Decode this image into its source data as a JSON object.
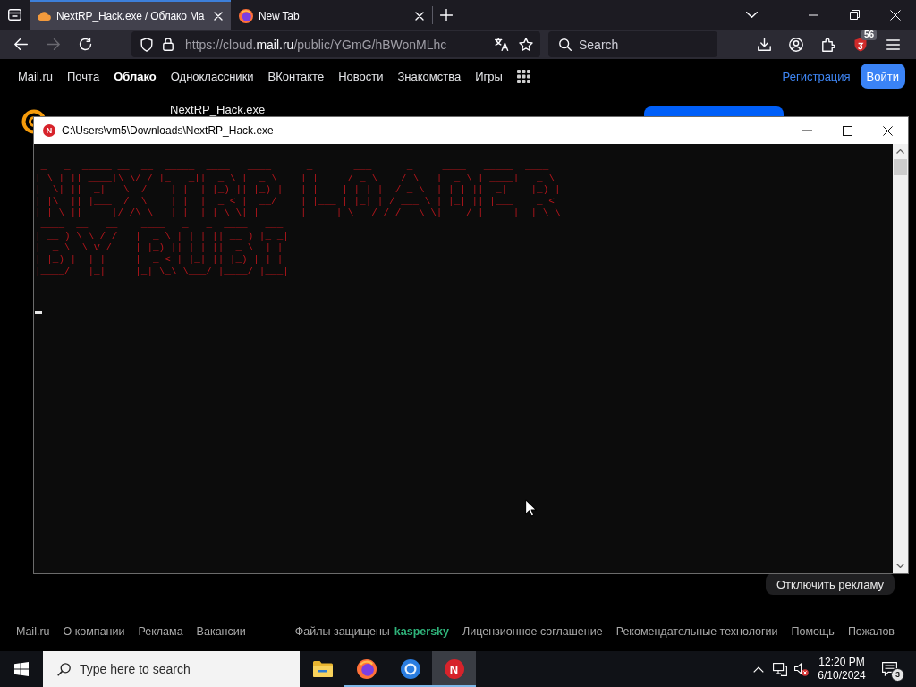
{
  "browser": {
    "tabs": [
      {
        "kind": "cloud",
        "title": "NextRP_Hack.exe / Облако Ma",
        "selected": true
      },
      {
        "kind": "browser",
        "title": "New Tab",
        "selected": false
      }
    ],
    "nav_buttons": [
      {
        "kind": "back",
        "disabled": false
      },
      {
        "kind": "forward",
        "disabled": true
      },
      {
        "kind": "reload",
        "disabled": false
      }
    ],
    "url": {
      "prefix": "https://cloud.",
      "domain": "mail.ru",
      "path": "/public/YGmG/hBWonMLhc"
    },
    "search": {
      "placeholder": "Search"
    },
    "extension_badge": "56"
  },
  "portal_nav": {
    "items": [
      {
        "label": "Mail.ru",
        "selected": false
      },
      {
        "label": "Почта",
        "selected": false
      },
      {
        "label": "Облако",
        "selected": true
      },
      {
        "label": "Одноклассники",
        "selected": false
      },
      {
        "label": "ВКонтакте",
        "selected": false
      },
      {
        "label": "Новости",
        "selected": false
      },
      {
        "label": "Знакомства",
        "selected": false
      },
      {
        "label": "Игры",
        "selected": false
      }
    ],
    "register_link": "Регистрация",
    "login_button": "Войти"
  },
  "cloud_header": {
    "file_name": "NextRP_Hack.exe"
  },
  "console_window": {
    "icon_letter": "N",
    "title": "C:\\Users\\vm5\\Downloads\\NextRP_Hack.exe",
    "banner_lines": [
      " _   _  _____ __  __  _____  ____   ____      _       ___      _     ____   _____  ____",
      "| \\ | || ____|\\ \\/ / |_   _||  _ \\ |  _ \\    | |     / _ \\    / \\   |  _ \\ | ____||  _ \\",
      "|  \\| ||  _|   \\  /    | |  | |_) || |_) |   | |    | | | |  / _ \\  | | | ||  _|  | |_) |",
      "| |\\  || |___  /  \\    | |  |  _ < |  __/    | |___ | |_| | / ___ \\ | |_| || |___ |  _ <",
      "|_| \\_||_____|/_/\\_\\   |_|  |_| \\_\\|_|       |_____| \\___/ /_/   \\_\\|____/ |_____||_| \\_\\",
      " ____  __   __    ____   _   _  ____   ___",
      "| __ ) \\ \\ / /   |  _ \\ | | | || __ ) |_ _|",
      "|  _ \\  \\ V /    | |_) || | | ||  _ \\  | |",
      "| |_) |  | |     |  _ < | |_| || |_) | | |",
      "|____/   |_|     |_| \\_\\ \\___/ |____/ |___|"
    ]
  },
  "ad_button": "Отключить рекламу",
  "footer": {
    "links": [
      "Mail.ru",
      "О компании",
      "Реклама",
      "Вакансии"
    ],
    "protection_label": "Файлы защищены",
    "protection_brand": "kaspersky",
    "more_links": [
      "Лицензионное соглашение",
      "Рекомендательные технологии",
      "Помощь",
      "Пожалов"
    ]
  },
  "taskbar": {
    "search": {
      "placeholder": "Type here to search"
    },
    "apps": [
      {
        "kind": "explorer",
        "running": false,
        "active": false
      },
      {
        "kind": "browser",
        "running": true,
        "active": false
      },
      {
        "kind": "ring",
        "running": true,
        "active": false
      },
      {
        "kind": "console",
        "letter": "N",
        "running": true,
        "active": true
      }
    ],
    "time": "12:20 PM",
    "date": "6/10/2024",
    "notification_count": "3"
  }
}
